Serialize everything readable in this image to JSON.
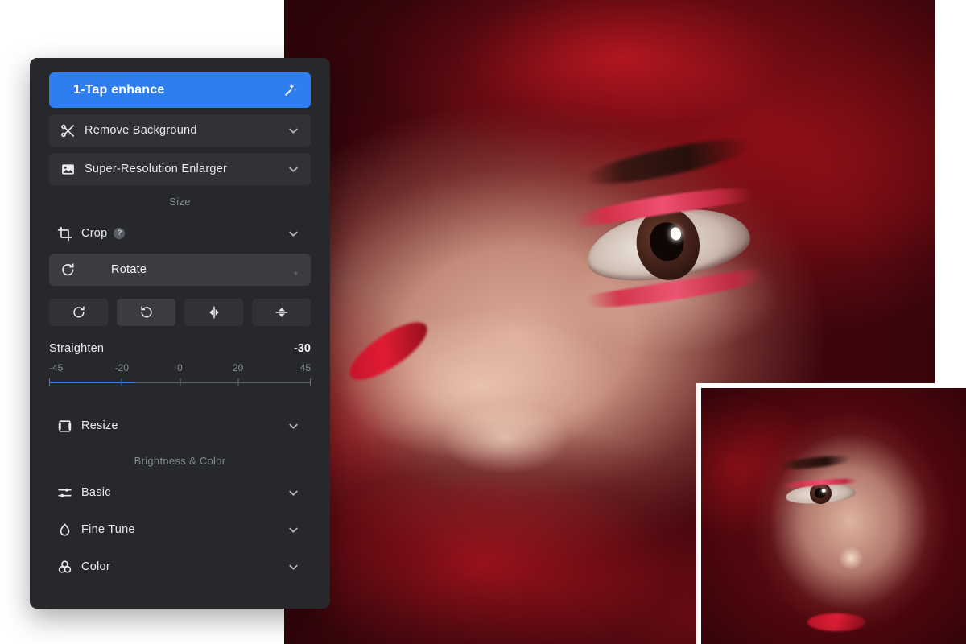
{
  "app": {
    "background_color": "#ffffff",
    "panel_bg": "#26282c",
    "accent_blue": "#2f7ef0",
    "row_bg": "#303237",
    "row_active_bg": "#3a3c41"
  },
  "panel": {
    "enhance": {
      "label": "1-Tap enhance",
      "icon": "magic-wand-icon"
    },
    "tools": [
      {
        "id": "remove-background",
        "label": "Remove  Background",
        "icon": "scissors-icon",
        "chevron": "chevron-down-icon"
      },
      {
        "id": "super-resolution-enlarger",
        "label": "Super-Resolution Enlarger",
        "icon": "image-icon",
        "chevron": "chevron-down-icon"
      }
    ],
    "sections": [
      {
        "id": "size",
        "label": "Size"
      },
      {
        "id": "brightness-color",
        "label": "Brightness & Color"
      }
    ],
    "crop": {
      "label": "Crop",
      "icon": "crop-icon",
      "help_badge": "?",
      "chevron": "chevron-down-icon"
    },
    "rotate": {
      "label": "Rotate",
      "icon": "rotate-cw-icon",
      "buttons": [
        {
          "id": "rotate-right",
          "icon": "rotate-cw-icon",
          "selected": false
        },
        {
          "id": "rotate-left",
          "icon": "rotate-ccw-icon",
          "selected": true
        },
        {
          "id": "flip-horizontal",
          "icon": "flip-horizontal-icon",
          "selected": false
        },
        {
          "id": "flip-vertical",
          "icon": "flip-vertical-icon",
          "selected": false
        }
      ],
      "straighten": {
        "label": "Straighten",
        "value": "-30",
        "value_number": -30,
        "min": -45,
        "max": 45,
        "fill_percent": 33,
        "ticks": [
          {
            "label": "-45",
            "pos_percent": 0
          },
          {
            "label": "-20",
            "pos_percent": 27.8
          },
          {
            "label": "0",
            "pos_percent": 50
          },
          {
            "label": "20",
            "pos_percent": 72.2
          },
          {
            "label": "45",
            "pos_percent": 100
          }
        ]
      }
    },
    "resize": {
      "label": "Resize",
      "icon": "resize-frame-icon",
      "chevron": "chevron-down-icon"
    },
    "color_tools": [
      {
        "id": "basic",
        "label": "Basic",
        "icon": "sliders-icon",
        "chevron": "chevron-down-icon"
      },
      {
        "id": "fine-tune",
        "label": "Fine Tune",
        "icon": "droplet-icon",
        "chevron": "chevron-down-icon"
      },
      {
        "id": "color",
        "label": "Color",
        "icon": "color-circles-icon",
        "chevron": "chevron-down-icon"
      }
    ]
  },
  "canvas": {
    "main_photo_alt": "Close-up portrait of a woman in a red hijab with red glitter eye makeup",
    "inset_photo_alt": "Wider crop of the same portrait shown as a thumbnail preview"
  }
}
